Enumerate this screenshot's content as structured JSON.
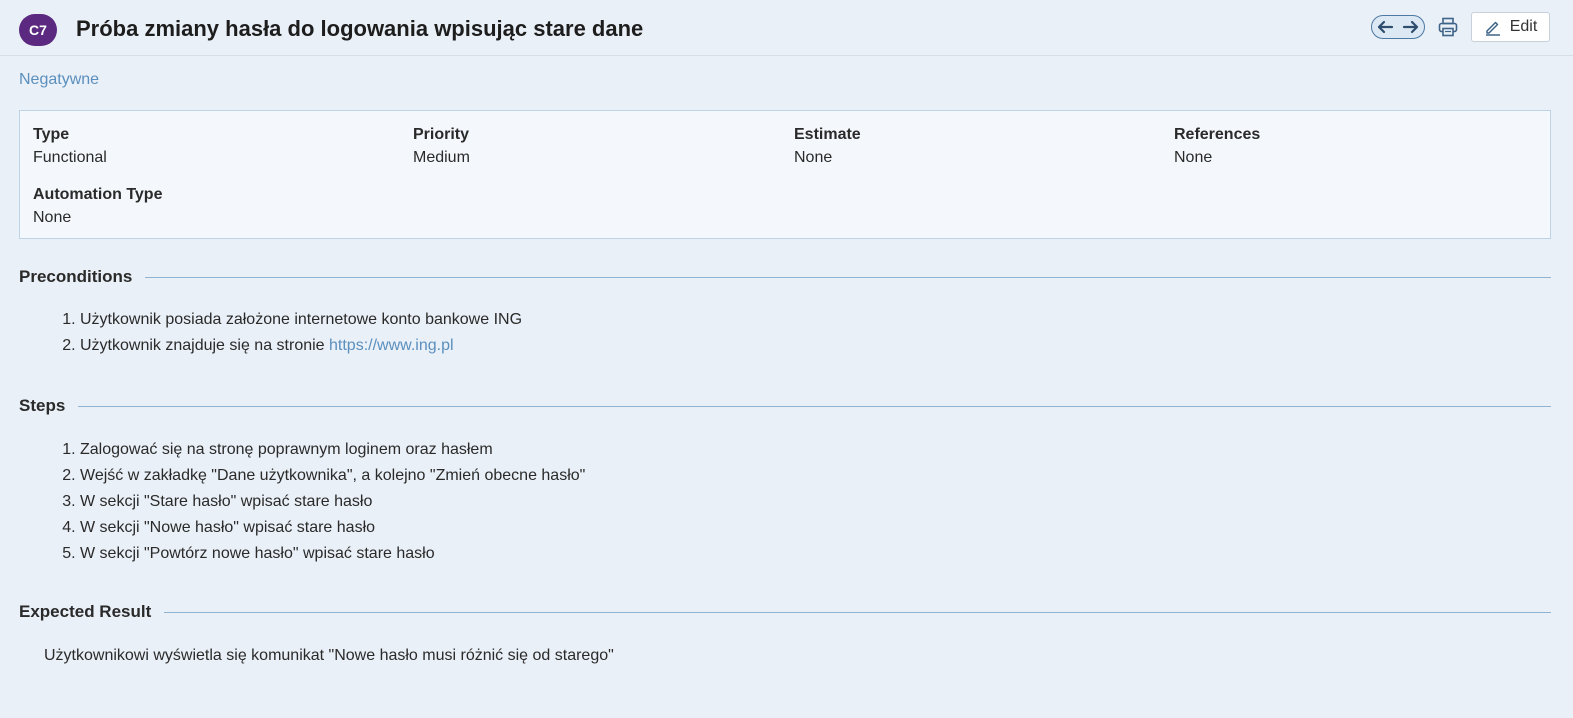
{
  "header": {
    "case_id": "C7",
    "title": "Próba zmiany hasła do logowania wpisując stare dane",
    "edit_label": "Edit",
    "icons": {
      "prev": "arrow-left-icon",
      "next": "arrow-right-icon",
      "print": "printer-icon",
      "edit": "pencil-icon"
    }
  },
  "section_label": "Negatywne",
  "details": {
    "type": {
      "label": "Type",
      "value": "Functional"
    },
    "priority": {
      "label": "Priority",
      "value": "Medium"
    },
    "estimate": {
      "label": "Estimate",
      "value": "None"
    },
    "references": {
      "label": "References",
      "value": "None"
    },
    "automation_type": {
      "label": "Automation Type",
      "value": "None"
    }
  },
  "preconditions": {
    "heading": "Preconditions",
    "items": [
      {
        "text": "Użytkownik posiada założone internetowe konto bankowe ING"
      },
      {
        "text": "Użytkownik znajduje się na stronie ",
        "link": "https://www.ing.pl"
      }
    ]
  },
  "steps": {
    "heading": "Steps",
    "items": [
      "Zalogować się na stronę poprawnym loginem oraz hasłem",
      "Wejść w zakładkę \"Dane użytkownika\", a kolejno \"Zmień obecne hasło\"",
      "W sekcji \"Stare hasło\" wpisać stare hasło",
      "W sekcji \"Nowe hasło\" wpisać stare hasło",
      "W sekcji \"Powtórz nowe hasło\" wpisać stare hasło"
    ]
  },
  "expected_result": {
    "heading": "Expected Result",
    "text": "Użytkownikowi wyświetla się komunikat \"Nowe hasło musi różnić się od starego\""
  },
  "colors": {
    "badge": "#5b2a80",
    "link": "#5a8fbe",
    "background": "#eaf0f7",
    "rule": "#8fb3d1"
  }
}
